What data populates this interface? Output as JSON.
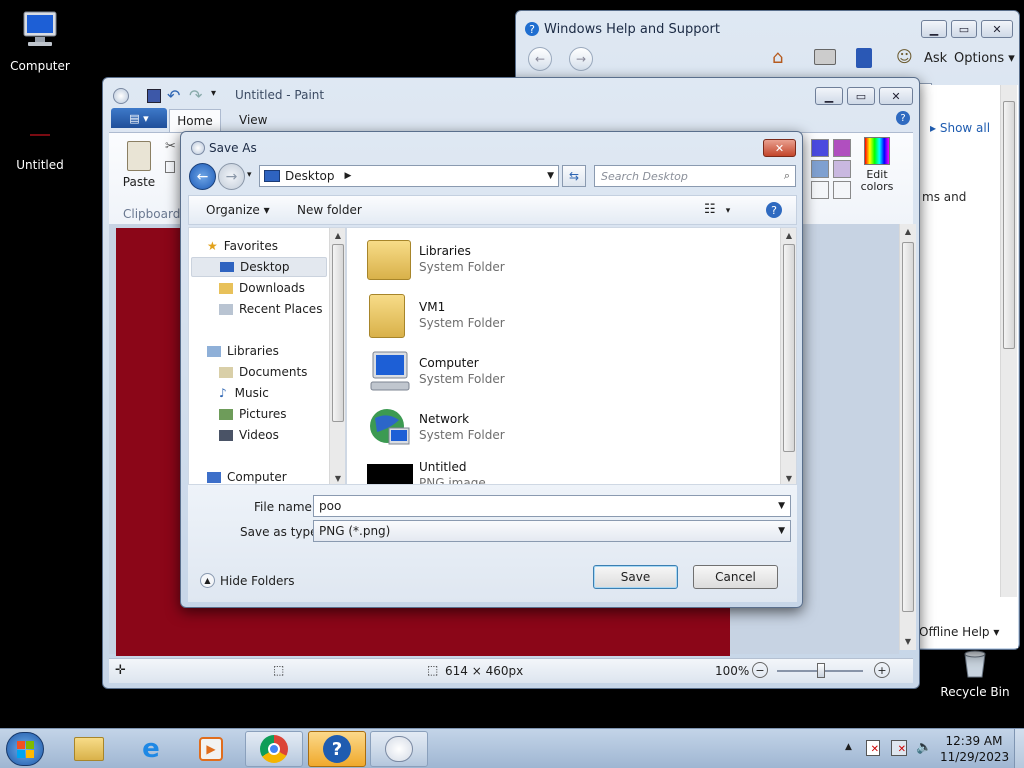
{
  "desktop": {
    "icons": [
      {
        "label": "Computer"
      },
      {
        "label": "Untitled"
      },
      {
        "label": "Recycle Bin"
      }
    ]
  },
  "help_window": {
    "title": "Windows Help and Support",
    "ask_label": "Ask",
    "options_label": "Options",
    "show_all": "Show all",
    "body_snippet": "ms and",
    "offline_help": "Offline Help"
  },
  "paint": {
    "title": "Untitled - Paint",
    "tabs": [
      "Home",
      "View"
    ],
    "paste_label": "Paste",
    "clipboard_label": "Clipboard",
    "edit_colors": "Edit colors",
    "status_size": "614 × 460px",
    "zoom": "100%",
    "colors": {
      "canvas": "#8b0618",
      "palette": [
        "#4a4adf",
        "#b04fbf",
        "#7fa0d0",
        "#c9b8e0"
      ]
    }
  },
  "save_dialog": {
    "title": "Save As",
    "address": "Desktop",
    "search_placeholder": "Search Desktop",
    "organize": "Organize",
    "new_folder": "New folder",
    "nav": {
      "favorites": "Favorites",
      "favorites_items": [
        "Desktop",
        "Downloads",
        "Recent Places"
      ],
      "libraries": "Libraries",
      "libraries_items": [
        "Documents",
        "Music",
        "Pictures",
        "Videos"
      ],
      "computer": "Computer"
    },
    "files": [
      {
        "name": "Libraries",
        "type": "System Folder"
      },
      {
        "name": "VM1",
        "type": "System Folder"
      },
      {
        "name": "Computer",
        "type": "System Folder"
      },
      {
        "name": "Network",
        "type": "System Folder"
      },
      {
        "name": "Untitled",
        "type": "PNG image"
      }
    ],
    "file_name_label": "File name:",
    "file_name_value": "poo",
    "save_type_label": "Save as type:",
    "save_type_value": "PNG (*.png)",
    "hide_folders": "Hide Folders",
    "save_button": "Save",
    "cancel_button": "Cancel"
  },
  "taskbar": {
    "time": "12:39 AM",
    "date": "11/29/2023"
  }
}
